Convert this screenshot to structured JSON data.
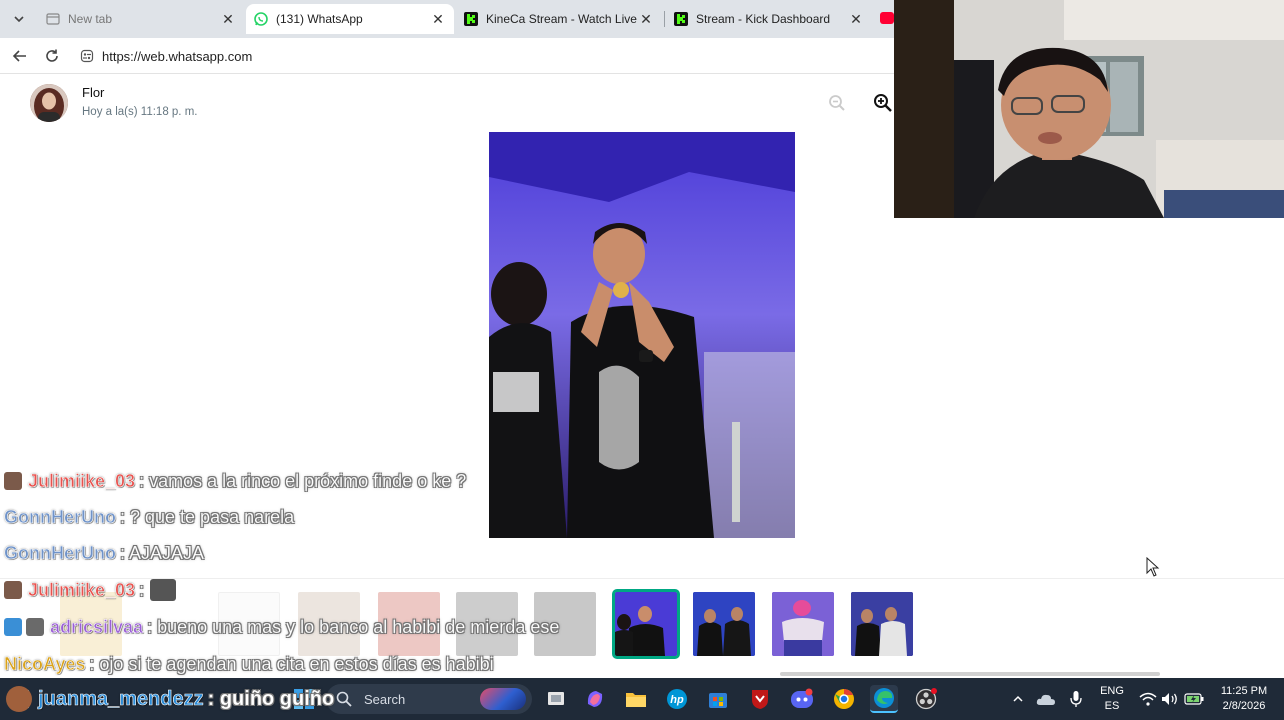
{
  "browser": {
    "tabs": [
      {
        "title": "New tab",
        "state": "inactive",
        "icon": "newtab-icon"
      },
      {
        "title": "(131) WhatsApp",
        "state": "active",
        "icon": "whatsapp-icon"
      },
      {
        "title": "KineCa Stream - Watch Live on",
        "state": "inactive",
        "icon": "kick-icon"
      },
      {
        "title": "Stream - Kick Dashboard",
        "state": "inactive",
        "icon": "kick-icon"
      }
    ],
    "url": "https://web.whatsapp.com"
  },
  "viewer": {
    "sender_name": "Flor",
    "timestamp": "Hoy a la(s) 11:18 p. m.",
    "thumbnail_count_visible": 11,
    "selected_thumbnail_index": 7
  },
  "chat": {
    "messages": [
      {
        "user": "Julimiike_03",
        "color": "#e8534f",
        "text": ": vamos a la rinco el próximo finde o ke ?"
      },
      {
        "user": "GonnHerUno",
        "color": "#6f93c9",
        "text": ": ? que te pasa narela"
      },
      {
        "user": "GonnHerUno",
        "color": "#6f93c9",
        "text": ": AJAJAJA"
      },
      {
        "user": "Julimiike_03",
        "color": "#e8534f",
        "text": ":"
      },
      {
        "user": "adricsilvaa",
        "color": "#9b5fd6",
        "text": ": bueno una mas y lo banco al habibi de mierda ese"
      },
      {
        "user": "NicoAyes",
        "color": "#d9a21a",
        "text": ": ojo si te agendan una cita en estos días es habibi"
      },
      {
        "user": "juanma_mendezz",
        "color": "#2b8bd6",
        "text": ": guiño guiño"
      }
    ]
  },
  "taskbar": {
    "search_placeholder": "Search",
    "language_top": "ENG",
    "language_bottom": "ES",
    "time": "11:25 PM",
    "date": "2/8/2026"
  },
  "colors": {
    "whatsapp_green": "#00a884",
    "kick_green": "#53fc18",
    "taskbar_bg": "#1f2a38"
  }
}
